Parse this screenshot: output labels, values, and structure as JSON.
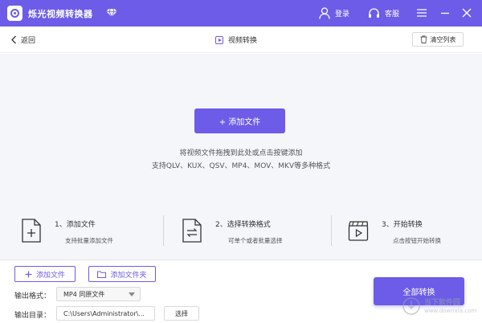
{
  "titlebar": {
    "app_title": "烁光视频转换器",
    "login_label": "登录",
    "service_label": "客服",
    "bg_color": "#6c5ce7",
    "icons": [
      "app-logo-icon",
      "diamond-vip-icon",
      "user-icon",
      "headset-icon",
      "menu-icon",
      "minimize-icon",
      "close-icon"
    ]
  },
  "subbar": {
    "back_label": "返回",
    "section_title": "视频转换",
    "clear_label": "清空列表"
  },
  "droparea": {
    "add_file_label": "+ 添加文件",
    "hint_line1": "将视频文件拖拽到此处或点击按键添加",
    "hint_line2": "支持QLV、KUX、QSV、MP4、MOV、MKV等多种格式"
  },
  "steps": [
    {
      "title": "1、添加文件",
      "desc": "支持批量添加文件",
      "icon": "add-file-icon"
    },
    {
      "title": "2、选择转换格式",
      "desc": "可单个或者批量选择",
      "icon": "convert-file-icon"
    },
    {
      "title": "3、开始转换",
      "desc": "点击按钮开始转换",
      "icon": "video-clip-icon"
    }
  ],
  "bottom": {
    "add_file_label": "添加文件",
    "add_folder_label": "添加文件夹",
    "format_label": "输出格式：",
    "format_value": "MP4 同原文件",
    "dir_label": "输出目录：",
    "dir_value": "C:\\Users\\Administrator\\...",
    "choose_label": "选择",
    "convert_all_label": "全部转换"
  },
  "watermark": {
    "text": "当下软件园",
    "url": "www.downxia.com"
  },
  "colors": {
    "accent": "#6c5ce7",
    "drop_bg": "#f5f6fa"
  }
}
